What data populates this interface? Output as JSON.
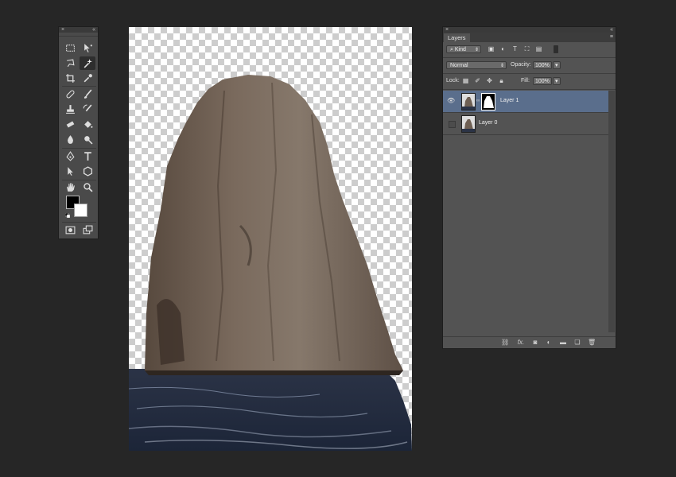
{
  "tools_panel": {
    "close_glyph": "×",
    "collapse_glyph": "«",
    "tools": [
      {
        "name": "move-icon",
        "glyph": "✥"
      },
      {
        "name": "marquee-icon",
        "glyph": "⬚"
      },
      {
        "name": "lasso-icon",
        "glyph": "ʘ"
      },
      {
        "name": "magic-wand-icon",
        "glyph": "✦"
      },
      {
        "name": "crop-icon",
        "glyph": "⌗"
      },
      {
        "name": "eyedropper-icon",
        "glyph": "✎"
      },
      {
        "name": "healing-brush-icon",
        "glyph": "✚"
      },
      {
        "name": "brush-icon",
        "glyph": "✐"
      },
      {
        "name": "stamp-icon",
        "glyph": "⍚"
      },
      {
        "name": "history-brush-icon",
        "glyph": "↺"
      },
      {
        "name": "eraser-icon",
        "glyph": "▭"
      },
      {
        "name": "paint-bucket-icon",
        "glyph": "◆"
      },
      {
        "name": "blur-icon",
        "glyph": "●"
      },
      {
        "name": "dodge-icon",
        "glyph": "🔍"
      },
      {
        "name": "pen-icon",
        "glyph": "✒"
      },
      {
        "name": "type-icon",
        "glyph": "T"
      },
      {
        "name": "path-selection-icon",
        "glyph": "➤"
      },
      {
        "name": "shape-icon",
        "glyph": "⬢"
      },
      {
        "name": "hand-icon",
        "glyph": "✋"
      },
      {
        "name": "zoom-icon",
        "glyph": "⚲"
      },
      {
        "name": "quick-mask-icon",
        "glyph": "◙"
      },
      {
        "name": "screen-mode-icon",
        "glyph": "❐"
      }
    ],
    "foreground_color": "#000000",
    "background_color": "#ffffff"
  },
  "layers_panel": {
    "close_glyph": "×",
    "collapse_glyph": "«",
    "tab_label": "Layers",
    "menu_glyph": "≡",
    "filter_label": "Kind",
    "filter_glyph": "⌕",
    "blend_mode": "Normal",
    "opacity_label": "Opacity:",
    "opacity_value": "100%",
    "lock_label": "Lock:",
    "fill_label": "Fill:",
    "fill_value": "100%",
    "layers": [
      {
        "name": "Layer 1",
        "visible": true,
        "selected": true,
        "has_mask": true
      },
      {
        "name": "Layer 0",
        "visible": false,
        "selected": false,
        "has_mask": false
      }
    ],
    "bottom_icons": [
      "link-icon",
      "fx-icon",
      "mask-icon",
      "adjustment-icon",
      "folder-icon",
      "new-layer-icon",
      "trash-icon"
    ],
    "fx_text": "fx."
  },
  "colors": {
    "background": "#262626",
    "panel": "#535353",
    "selected_layer": "#5a6e8c"
  }
}
